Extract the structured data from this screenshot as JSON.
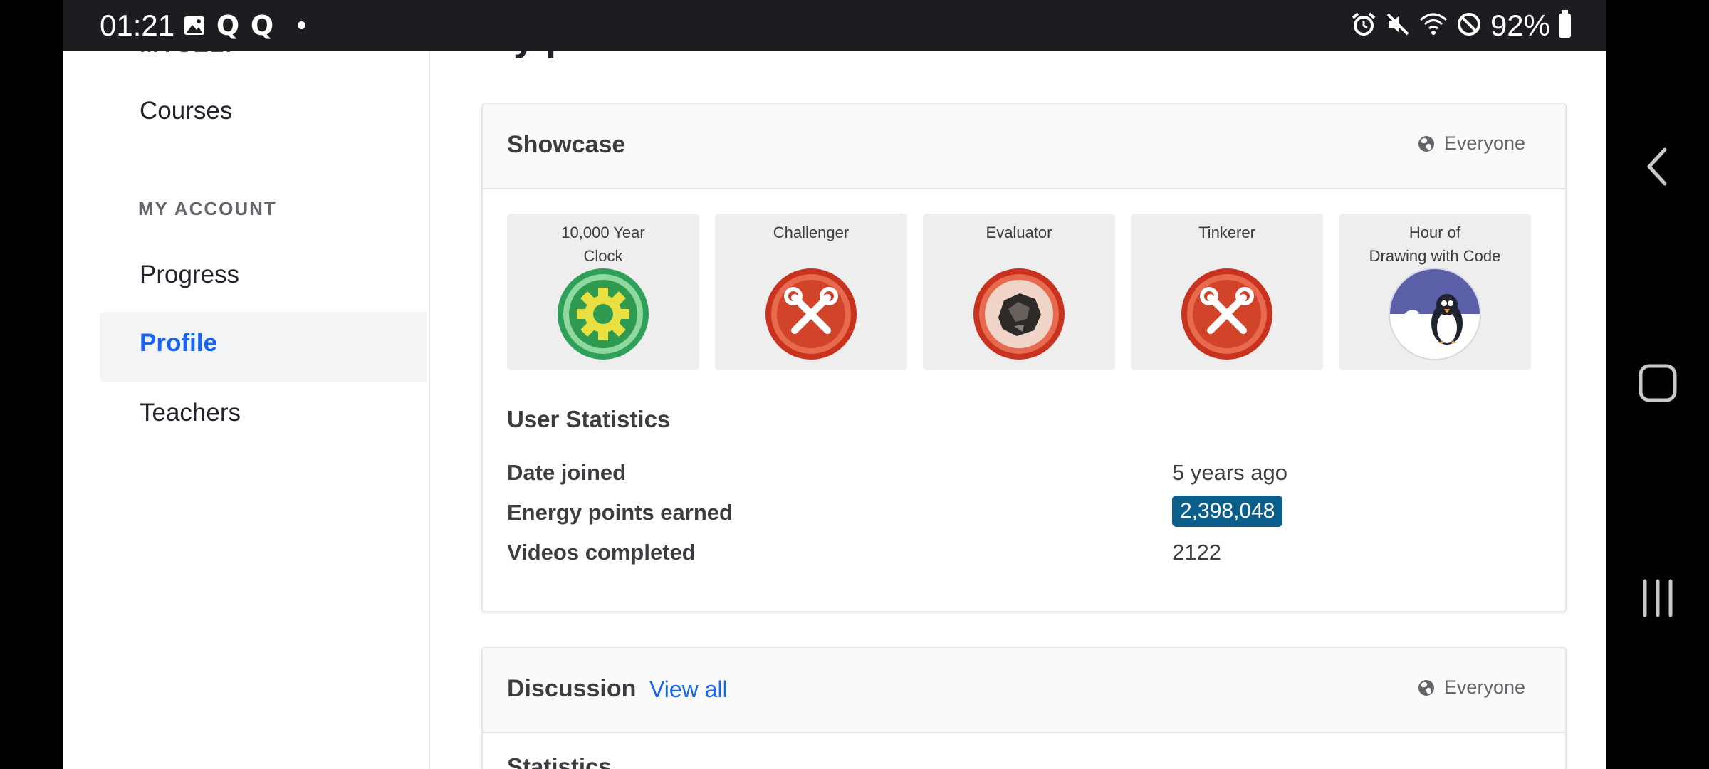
{
  "status_bar": {
    "time": "01:21",
    "battery_text": "92%"
  },
  "sidebar": {
    "cut_label": "MYSELF",
    "items": [
      {
        "label": "Courses"
      },
      {
        "label": "Progress"
      },
      {
        "label": "Profile"
      },
      {
        "label": "Teachers"
      }
    ],
    "section_label": "MY ACCOUNT",
    "active_item": "Profile"
  },
  "main": {
    "page_title": "My profile",
    "showcase": {
      "title": "Showcase",
      "visibility": "Everyone",
      "badges": [
        {
          "title": "10,000 Year\nClock",
          "icon": "gear-badge-icon"
        },
        {
          "title": "Challenger",
          "icon": "tools-badge-icon"
        },
        {
          "title": "Evaluator",
          "icon": "meteorite-badge-icon"
        },
        {
          "title": "Tinkerer",
          "icon": "tools-badge-icon"
        },
        {
          "title": "Hour of\nDrawing with Code",
          "icon": "penguin-badge-icon"
        }
      ],
      "stats_title": "User Statistics",
      "stats": [
        {
          "label": "Date joined",
          "value": "5 years ago"
        },
        {
          "label": "Energy points earned",
          "value": "2,398,048"
        },
        {
          "label": "Videos completed",
          "value": "2122"
        }
      ]
    },
    "discussion": {
      "title": "Discussion",
      "link": "View all",
      "visibility": "Everyone",
      "cut_heading": "Statistics"
    }
  },
  "colors": {
    "accent": "#1865f2",
    "energy_pill": "#0c5e8a",
    "status_bar_bg": "#1b1d21"
  }
}
